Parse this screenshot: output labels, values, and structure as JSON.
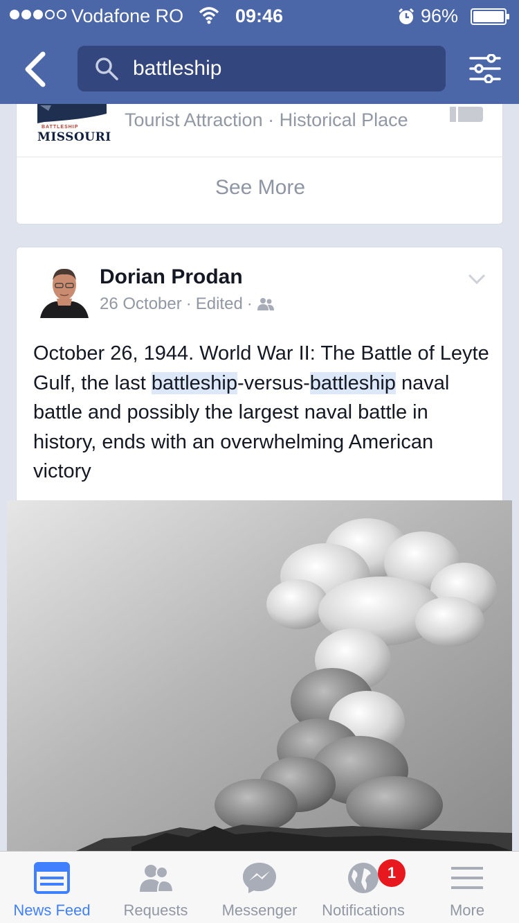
{
  "status_bar": {
    "carrier": "Vodafone RO",
    "time": "09:46",
    "battery": "96%",
    "signal_bars_filled": 3,
    "signal_bars_total": 5,
    "battery_level": 0.96
  },
  "navbar": {
    "search_value": "battleship",
    "icons": [
      "back-icon",
      "search-icon",
      "filter-icon"
    ]
  },
  "result_card": {
    "logo_small": "BATTLESHIP",
    "logo_big": "MISSOURI",
    "subtitle": "Tourist Attraction · Historical Place",
    "see_more": "See More"
  },
  "post": {
    "author": "Dorian Prodan",
    "date": "26 October",
    "edited": "Edited",
    "sep": "·",
    "text_parts": {
      "p1": "October 26, 1944. World War II: The Battle of Leyte Gulf, the last ",
      "h1": "battleship",
      "p2": "-versus-",
      "h2": "battleship",
      "p3": " naval battle and possibly the largest naval battle in history, ends with an overwhelming American victory"
    }
  },
  "tabs": [
    {
      "label": "News Feed",
      "icon": "news-feed-icon",
      "active": true
    },
    {
      "label": "Requests",
      "icon": "requests-icon",
      "active": false
    },
    {
      "label": "Messenger",
      "icon": "messenger-icon",
      "active": false
    },
    {
      "label": "Notifications",
      "icon": "notifications-icon",
      "active": false
    },
    {
      "label": "More",
      "icon": "more-icon",
      "active": false
    }
  ],
  "notifications_badge": "1",
  "colors": {
    "brand_blue": "#4b67a8",
    "search_field": "#33477e",
    "active_tab": "#4080ff",
    "badge_red": "#e8181f",
    "highlight": "#dce7f8"
  }
}
